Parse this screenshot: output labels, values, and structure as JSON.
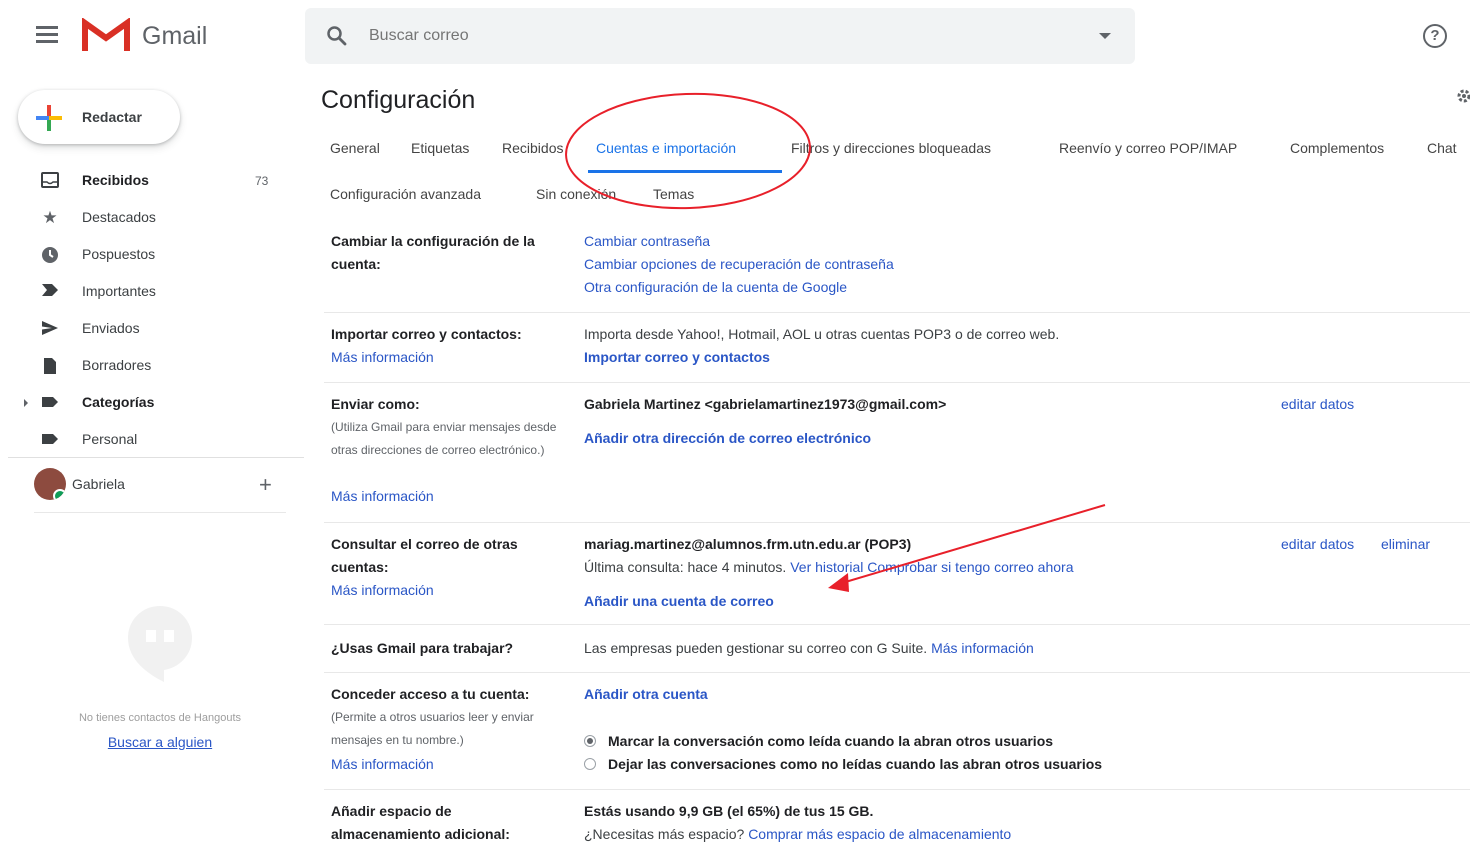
{
  "header": {
    "app_name": "Gmail",
    "search_placeholder": "Buscar correo"
  },
  "sidebar": {
    "compose_label": "Redactar",
    "items": [
      {
        "label": "Recibidos",
        "icon": "inbox-icon",
        "bold": true,
        "count": "73"
      },
      {
        "label": "Destacados",
        "icon": "star-icon"
      },
      {
        "label": "Pospuestos",
        "icon": "clock-icon"
      },
      {
        "label": "Importantes",
        "icon": "important-icon"
      },
      {
        "label": "Enviados",
        "icon": "send-icon"
      },
      {
        "label": "Borradores",
        "icon": "draft-icon"
      },
      {
        "label": "Categorías",
        "icon": "label-icon",
        "bold": true
      },
      {
        "label": "Personal",
        "icon": "label-icon"
      }
    ],
    "user_name": "Gabriela",
    "hangouts_empty": "No tienes contactos de Hangouts",
    "hangouts_find": "Buscar a alguien"
  },
  "main": {
    "title": "Configuración",
    "tabs": [
      "General",
      "Etiquetas",
      "Recibidos",
      "Cuentas e importación",
      "Filtros y direcciones bloqueadas",
      "Reenvío y correo POP/IMAP",
      "Complementos",
      "Chat",
      "Configuración avanzada",
      "Sin conexión",
      "Temas"
    ],
    "active_tab": "Cuentas e importación",
    "sections": {
      "account": {
        "label": "Cambiar la configuración de la cuenta:",
        "links": [
          "Cambiar contraseña",
          "Cambiar opciones de recuperación de contraseña",
          "Otra configuración de la cuenta de Google"
        ]
      },
      "import": {
        "label": "Importar correo y contactos:",
        "more": "Más información",
        "desc": "Importa desde Yahoo!, Hotmail, AOL u otras cuentas POP3 o de correo web.",
        "action": "Importar correo y contactos"
      },
      "send_as": {
        "label": "Enviar como:",
        "note": "(Utiliza Gmail para enviar mensajes desde otras direcciones de correo electrónico.)",
        "more": "Más información",
        "address": "Gabriela Martinez <gabrielamartinez1973@gmail.com>",
        "action": "Añadir otra dirección de correo electrónico",
        "edit": "editar datos"
      },
      "check_mail": {
        "label": "Consultar el correo de otras cuentas:",
        "more": "Más información",
        "account": "mariag.martinez@alumnos.frm.utn.edu.ar (POP3)",
        "last_check": "Última consulta: hace 4 minutos.",
        "history": "Ver historial",
        "check_now": "Comprobar si tengo correo ahora",
        "action": "Añadir una cuenta de correo",
        "edit": "editar datos",
        "delete": "eliminar"
      },
      "work": {
        "label": "¿Usas Gmail para trabajar?",
        "desc": "Las empresas pueden gestionar su correo con G Suite.",
        "more": "Más información"
      },
      "grant": {
        "label": "Conceder acceso a tu cuenta:",
        "note": "(Permite a otros usuarios leer y enviar mensajes en tu nombre.)",
        "more": "Más información",
        "action": "Añadir otra cuenta",
        "option_read": "Marcar la conversación como leída cuando la abran otros usuarios",
        "option_unread": "Dejar las conversaciones como no leídas cuando las abran otros usuarios",
        "selected": "option_read"
      },
      "storage": {
        "label": "Añadir espacio de almacenamiento adicional:",
        "usage": "Estás usando 9,9 GB (el 65%) de tus 15 GB.",
        "need": "¿Necesitas más espacio?",
        "buy": "Comprar más espacio de almacenamiento"
      }
    }
  },
  "colors": {
    "gmail_red": "#d93025",
    "link": "#2a56c6",
    "active_tab": "#1a73e8",
    "annotation": "#e8202a"
  }
}
